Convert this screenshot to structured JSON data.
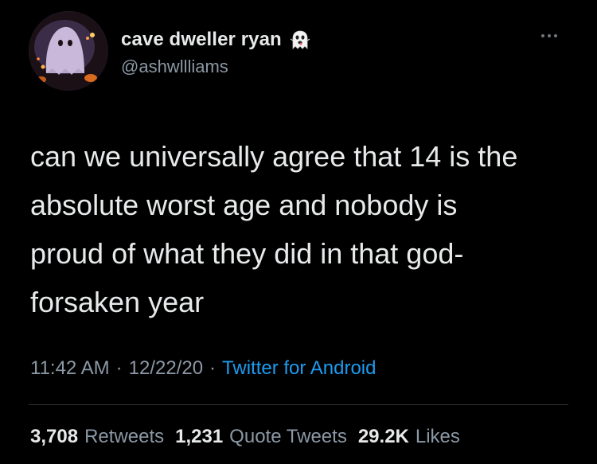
{
  "author": {
    "display_name": "cave dweller ryan",
    "handle": "@ashwllliams",
    "emoji_icon": "ghost-emoji"
  },
  "tweet": {
    "text": "can we universally agree that 14 is the\nabsolute worst age and nobody is\nproud of what they did in that god-\nforsaken year"
  },
  "meta": {
    "time": "11:42 AM",
    "separator1": "·",
    "date": "12/22/20",
    "separator2": "·",
    "source": "Twitter for Android"
  },
  "stats": {
    "retweets_count": "3,708",
    "retweets_label": "Retweets",
    "quotes_count": "1,231",
    "quotes_label": "Quote Tweets",
    "likes_count": "29.2K",
    "likes_label": "Likes"
  },
  "colors": {
    "background": "#000000",
    "text": "#e7e9ea",
    "muted": "#8b98a5",
    "link": "#1d9bf0"
  }
}
